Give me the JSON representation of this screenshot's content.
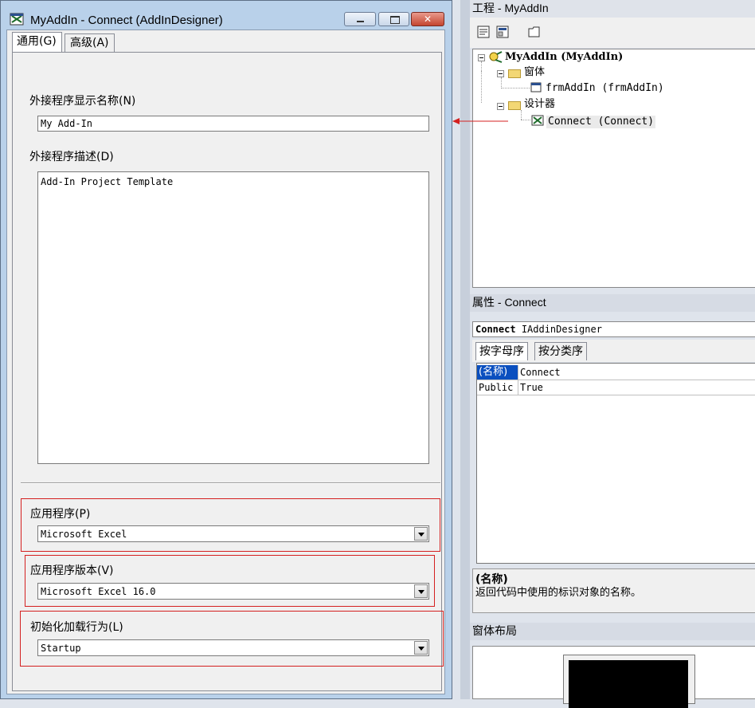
{
  "dialog": {
    "title": "MyAddIn - Connect (AddInDesigner)",
    "minimize_glyph": "–",
    "close_glyph": "✕",
    "tabs": [
      {
        "label": "通用(G)"
      },
      {
        "label": "高级(A)"
      }
    ],
    "display_name": {
      "label": "外接程序显示名称(N)",
      "value": "My Add-In"
    },
    "description": {
      "label": "外接程序描述(D)",
      "value": "Add-In Project Template"
    },
    "application": {
      "label": "应用程序(P)",
      "value": "Microsoft Excel"
    },
    "app_version": {
      "label": "应用程序版本(V)",
      "value": "Microsoft Excel 16.0"
    },
    "load_behavior": {
      "label": "初始化加载行为(L)",
      "value": "Startup"
    }
  },
  "project_explorer": {
    "title": "工程 - MyAddIn",
    "tree": {
      "root": "MyAddIn (MyAddIn)",
      "forms_folder": "窗体",
      "form_item": "frmAddIn (frmAddIn)",
      "designers_folder": "设计器",
      "designer_item": "Connect (Connect)"
    }
  },
  "properties": {
    "title": "属性 - Connect",
    "object_name": "Connect",
    "object_type": "IAddinDesigner",
    "tabs": [
      {
        "label": "按字母序"
      },
      {
        "label": "按分类序"
      }
    ],
    "rows": [
      {
        "name": "(名称)",
        "value": "Connect"
      },
      {
        "name": "Public",
        "value": "True"
      }
    ],
    "description_title": "(名称)",
    "description_body": "返回代码中使用的标识对象的名称。"
  },
  "form_layout": {
    "title": "窗体布局"
  },
  "colors": {
    "highlight_box": "#d42020",
    "selection": "#0a4fbf"
  }
}
